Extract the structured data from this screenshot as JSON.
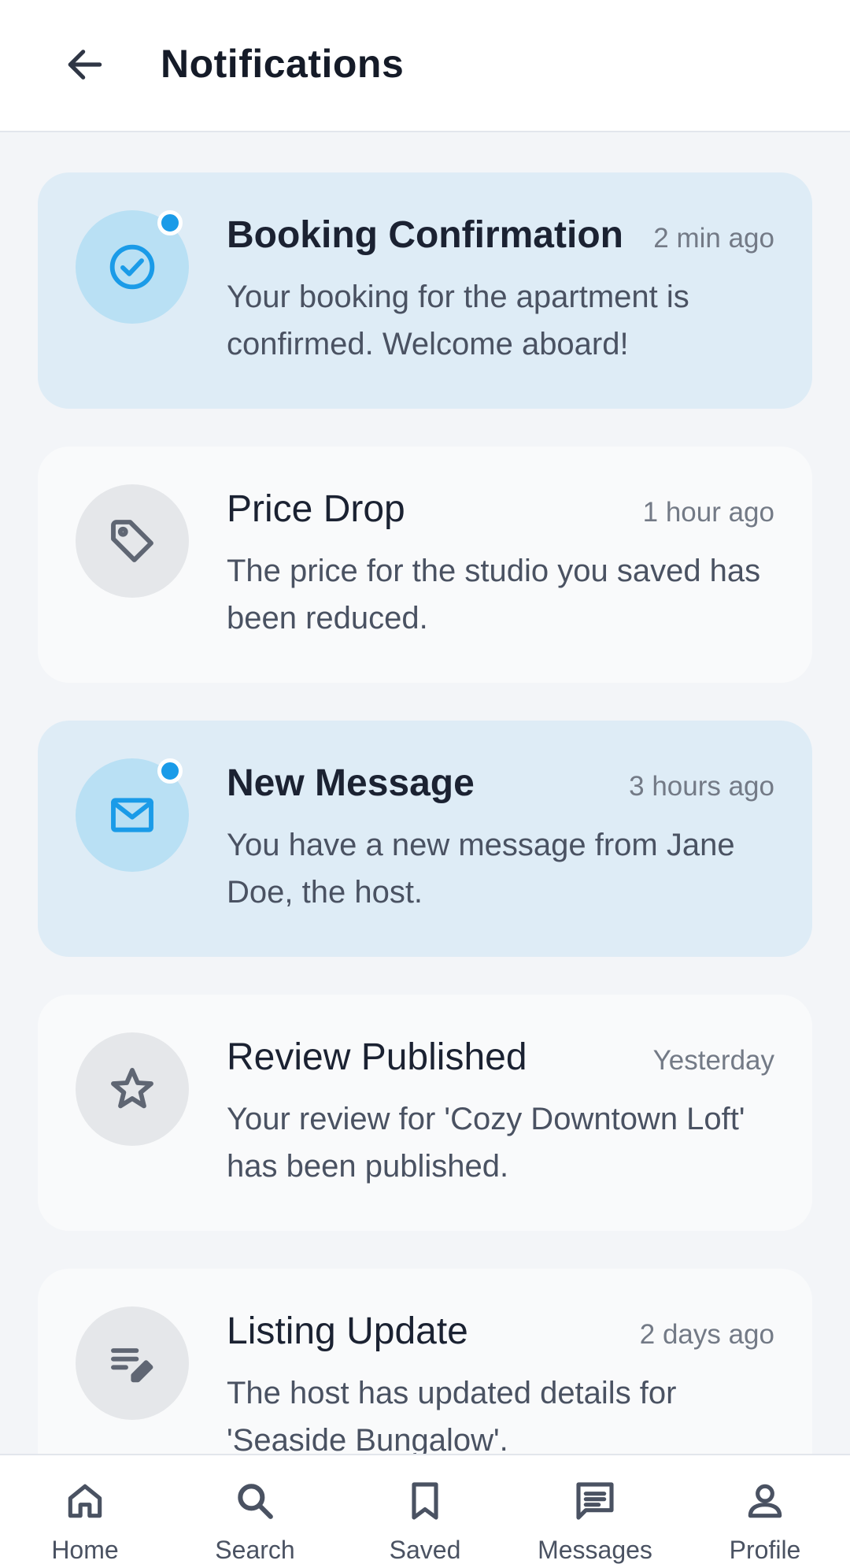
{
  "header": {
    "title": "Notifications",
    "back_icon": "arrow-left-icon"
  },
  "notifications": [
    {
      "title": "Booking Confirmation",
      "time": "2 min ago",
      "body": "Your booking for the apartment is confirmed. Welcome aboard!",
      "icon": "check-circle-icon",
      "unread": true
    },
    {
      "title": "Price Drop",
      "time": "1 hour ago",
      "body": "The price for the studio you saved has been reduced.",
      "icon": "tag-icon",
      "unread": false
    },
    {
      "title": "New Message",
      "time": "3 hours ago",
      "body": "You have a new message from Jane Doe, the host.",
      "icon": "mail-icon",
      "unread": true
    },
    {
      "title": "Review Published",
      "time": "Yesterday",
      "body": "Your review for 'Cozy Downtown Loft' has been published.",
      "icon": "star-icon",
      "unread": false
    },
    {
      "title": "Listing Update",
      "time": "2 days ago",
      "body": "The host has updated details for 'Seaside Bungalow'.",
      "icon": "edit-note-icon",
      "unread": false
    }
  ],
  "bottom_nav": [
    {
      "label": "Home",
      "icon": "home-icon"
    },
    {
      "label": "Search",
      "icon": "search-icon"
    },
    {
      "label": "Saved",
      "icon": "bookmark-icon"
    },
    {
      "label": "Messages",
      "icon": "chat-icon"
    },
    {
      "label": "Profile",
      "icon": "person-icon"
    }
  ],
  "colors": {
    "accent": "#1a9be8",
    "unread_card": "#deecf6",
    "read_card": "#f9fafb",
    "icon_muted": "#5f6673"
  }
}
